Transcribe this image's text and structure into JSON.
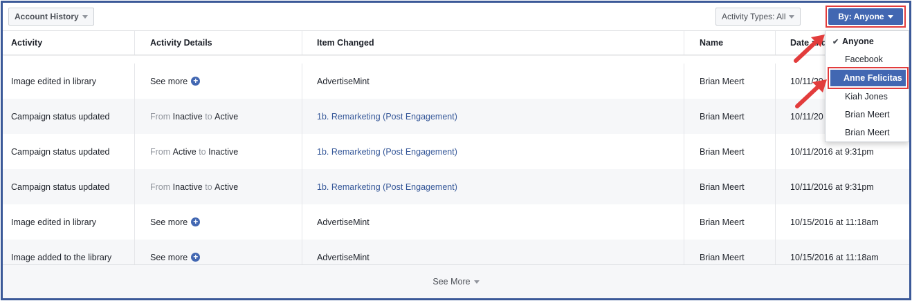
{
  "toolbar": {
    "account_history_label": "Account History",
    "activity_types_label": "Activity Types: All",
    "by_label": "By: Anyone"
  },
  "table": {
    "headers": [
      "Activity",
      "Activity Details",
      "Item Changed",
      "Name",
      "Date and"
    ],
    "rows": [
      {
        "activity": "Image edited in library",
        "details_link": "See more",
        "item": "AdvertiseMint",
        "name": "Brian Meert",
        "date": "10/11/20"
      },
      {
        "activity": "Campaign status updated",
        "from": "From",
        "state1": "Inactive",
        "to": "to",
        "state2": "Active",
        "item": "1b. Remarketing (Post Engagement)",
        "name": "Brian Meert",
        "date": "10/11/20"
      },
      {
        "activity": "Campaign status updated",
        "from": "From",
        "state1": "Active",
        "to": "to",
        "state2": "Inactive",
        "item": "1b. Remarketing (Post Engagement)",
        "name": "Brian Meert",
        "date": "10/11/2016 at 9:31pm"
      },
      {
        "activity": "Campaign status updated",
        "from": "From",
        "state1": "Inactive",
        "to": "to",
        "state2": "Active",
        "item": "1b. Remarketing (Post Engagement)",
        "name": "Brian Meert",
        "date": "10/11/2016 at 9:31pm"
      },
      {
        "activity": "Image edited in library",
        "details_link": "See more",
        "item": "AdvertiseMint",
        "name": "Brian Meert",
        "date": "10/15/2016 at 11:18am"
      },
      {
        "activity": "Image added to the library",
        "details_link": "See more",
        "item": "AdvertiseMint",
        "name": "Brian Meert",
        "date": "10/15/2016 at 11:18am"
      }
    ]
  },
  "footer": {
    "see_more_label": "See More"
  },
  "dropdown": {
    "items": [
      "Anyone",
      "Facebook",
      "Anne Felicitas",
      "Kiah Jones",
      "Brian Meert",
      "Brian Meert"
    ],
    "selected_mark": "✔"
  },
  "colors": {
    "brand": "#4267b2",
    "highlight": "#e23c3c",
    "link": "#365899"
  },
  "icons": {
    "plus": "plus-circle-icon",
    "caret": "caret-down-icon",
    "check": "check-icon",
    "arrow": "red-arrow-icon"
  }
}
